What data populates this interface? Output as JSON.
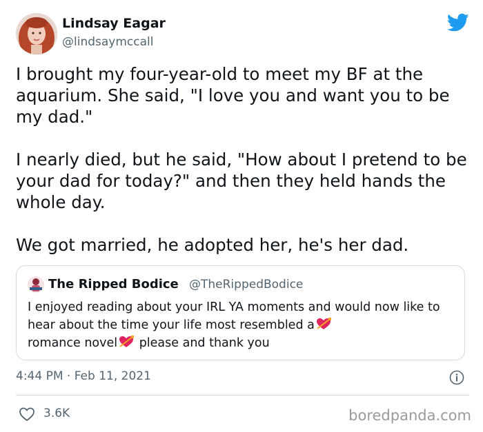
{
  "tweet": {
    "author_name": "Lindsay Eagar",
    "author_handle": "@lindsaymccall",
    "paragraphs": [
      "I brought my four-year-old to meet my BF at the aquarium. She said, \"I love you and want you to be my dad.\"",
      "I nearly died, but he said, \"How about I pretend to be your dad for today?\" and then they held hands the whole day.",
      "We got married, he adopted her, he's her dad."
    ],
    "timestamp": "4:44 PM · Feb 11, 2021",
    "likes": "3.6K"
  },
  "quoted": {
    "author_name": "The Ripped Bodice",
    "author_handle": "@TheRippedBodice",
    "text_part1": "I enjoyed reading about your IRL YA  moments and would now like to hear about the time your life most resembled a",
    "text_part2": "romance novel",
    "text_part3": " please and thank you"
  },
  "watermark": "boredpanda.com",
  "icons": {
    "brand": "twitter-bird-icon",
    "info": "info-icon",
    "like": "heart-outline-icon",
    "emoji": "heart-with-arrow-emoji"
  },
  "colors": {
    "twitter_blue": "#1d9bf0",
    "text": "#0f1419",
    "secondary_text": "#536471",
    "border": "#cfd9de",
    "watermark": "#9a9a9a"
  }
}
